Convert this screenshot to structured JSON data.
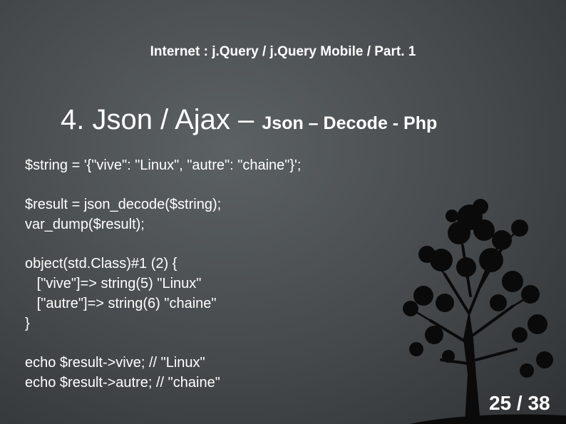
{
  "header": {
    "supertitle": "Internet : j.Query / j.Query Mobile / Part. 1"
  },
  "title": {
    "main": "4. Json / Ajax – ",
    "sub": "Json – Decode - Php"
  },
  "code": {
    "line1": "$string = '{\"vive\": \"Linux\", \"autre\": \"chaine\"}';",
    "line2": "$result = json_decode($string);",
    "line3": "var_dump($result);",
    "line4": "object(std.Class)#1 (2) {",
    "line5": "   [\"vive\"]=> string(5) \"Linux\"",
    "line6": "   [\"autre\"]=> string(6) \"chaine\"",
    "line7": "}",
    "line8": "echo $result->vive; // \"Linux\"",
    "line9": "echo $result->autre; // \"chaine\""
  },
  "footer": {
    "page": "25 / 38"
  },
  "colors": {
    "background": "#45494c",
    "text": "#ffffff",
    "tree": "#0a0a0a"
  }
}
